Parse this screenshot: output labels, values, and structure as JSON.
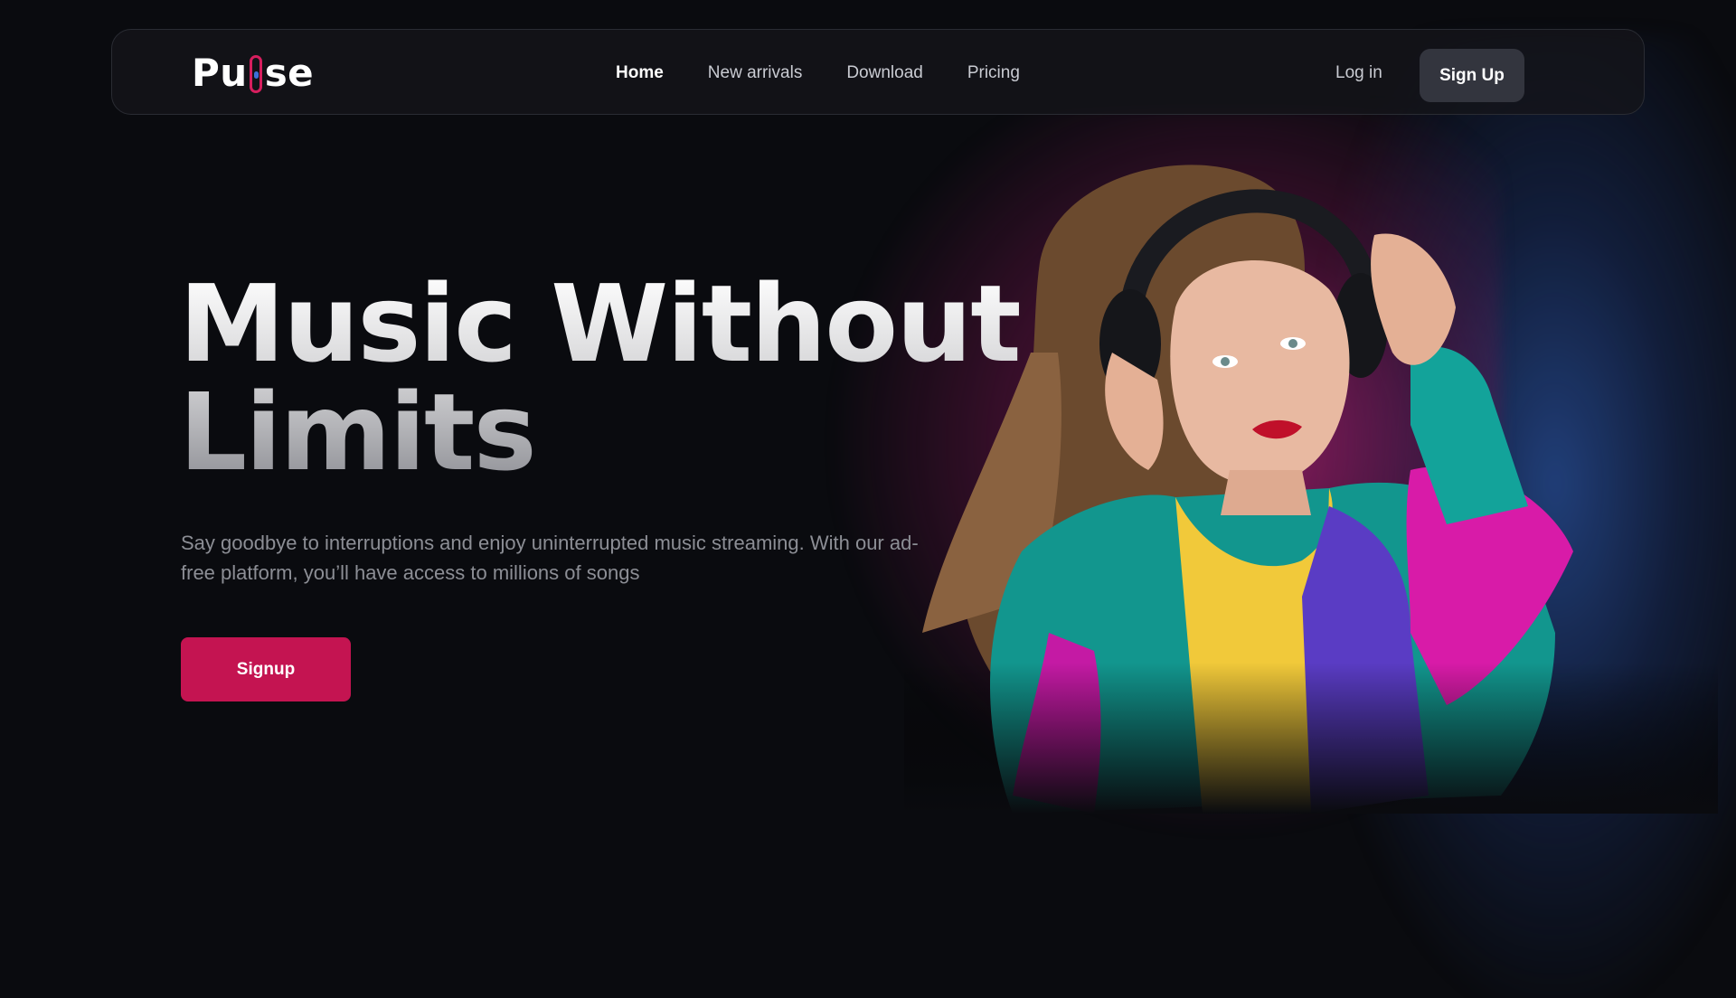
{
  "nav": {
    "logo_text_start": "Pu",
    "logo_text_end": "se",
    "links": [
      {
        "label": "Home",
        "active": true
      },
      {
        "label": "New arrivals",
        "active": false
      },
      {
        "label": "Download",
        "active": false
      },
      {
        "label": "Pricing",
        "active": false
      }
    ],
    "login_label": "Log in",
    "signup_label": "Sign Up"
  },
  "hero": {
    "title_line1": "Music Without",
    "title_line2": "Limits",
    "subtitle_line1": "Say goodbye to interruptions and enjoy uninterrupted music streaming. With our ad-",
    "subtitle_line2": "free platform, you’ll have access to millions of songs",
    "cta_label": "Signup"
  },
  "colors": {
    "background": "#0a0b0f",
    "accent": "#c41451",
    "nav_button": "#33353e",
    "glow_pink": "#c8288c",
    "glow_blue": "#25488c"
  }
}
